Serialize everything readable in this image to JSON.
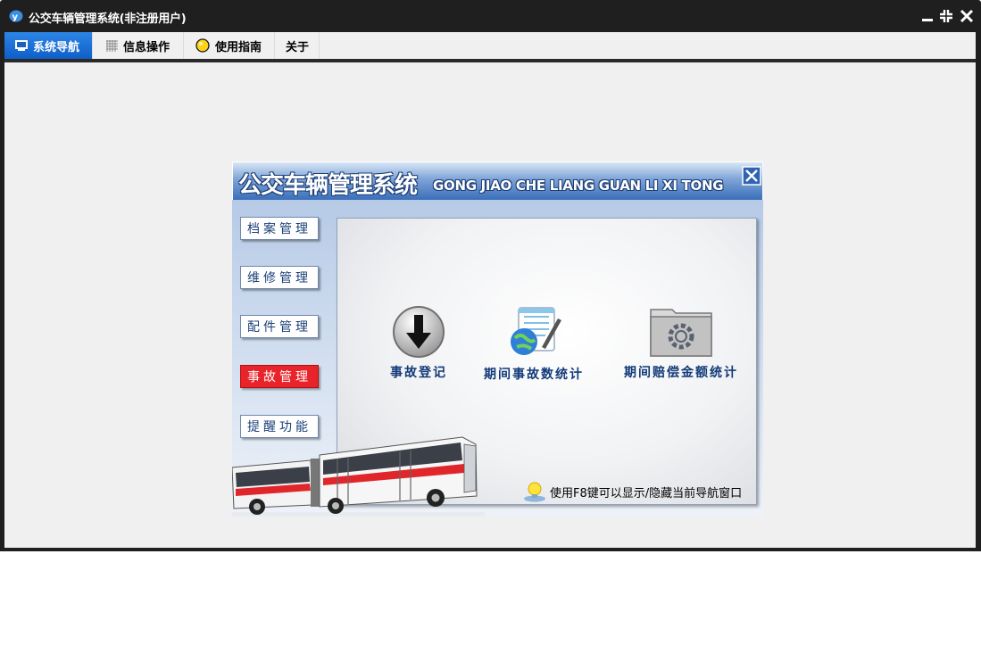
{
  "window": {
    "title": "公交车辆管理系统(非注册用户)"
  },
  "tabs": [
    {
      "label": "系统导航",
      "icon": "monitor-icon",
      "active": true
    },
    {
      "label": "信息操作",
      "icon": "grid-icon",
      "active": false
    },
    {
      "label": "使用指南",
      "icon": "lightbulb-icon",
      "active": false
    },
    {
      "label": "关于",
      "icon": "",
      "active": false
    }
  ],
  "nav": {
    "title": "公交车辆管理系统",
    "subtitle": "GONG JIAO CHE LIANG GUAN LI XI TONG",
    "sidebar": [
      {
        "label": "档案管理",
        "active": false
      },
      {
        "label": "维修管理",
        "active": false
      },
      {
        "label": "配件管理",
        "active": false
      },
      {
        "label": "事故管理",
        "active": true
      },
      {
        "label": "提醒功能",
        "active": false
      }
    ],
    "features": [
      {
        "label": "事故登记",
        "icon": "download-arrow-icon"
      },
      {
        "label": "期间事故数统计",
        "icon": "globe-notepad-icon"
      },
      {
        "label": "期间赔偿金额统计",
        "icon": "folder-gear-icon"
      }
    ],
    "tip": "使用F8键可以显示/隐藏当前导航窗口"
  },
  "colors": {
    "active_tab": "#1a70d6",
    "active_sidebar": "#e8242a",
    "label_blue": "#123a78"
  }
}
